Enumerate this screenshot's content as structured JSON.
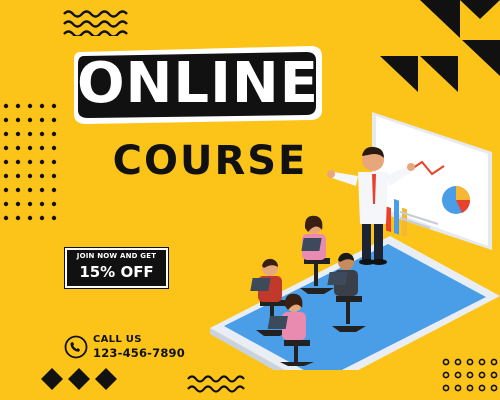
{
  "headline": {
    "line1": "ONLINE",
    "line2": "COURSE"
  },
  "promo": {
    "line1": "JOIN NOW AND GET",
    "line2": "15% OFF"
  },
  "contact": {
    "label": "CALL US",
    "phone": "123-456-7890"
  },
  "icons": {
    "phone": "phone-icon",
    "wave": "wave-decoration",
    "dots": "dot-grid-decoration",
    "diamonds": "diamond-decoration",
    "triangles": "triangle-decoration"
  },
  "colors": {
    "background": "#fcc419",
    "dark": "#111111",
    "light": "#ffffff",
    "tablet": "#4a9ee8",
    "chart_accent": "#e8412c"
  }
}
